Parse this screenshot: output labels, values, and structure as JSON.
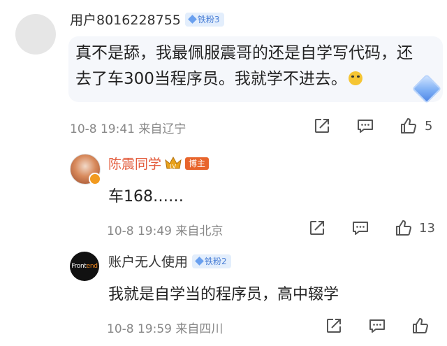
{
  "main_comment": {
    "username": "用户8016228755",
    "badge": "铁粉3",
    "text": "真不是舔，我最佩服震哥的还是自学写代码，还去了车300当程序员。我就学不进去。",
    "time": "10-8 19:41",
    "location": "来自辽宁",
    "likes": "5"
  },
  "replies": [
    {
      "username": "陈震同学",
      "badge": "博主",
      "text": "车168……",
      "time": "10-8 19:49",
      "location": "来自北京",
      "likes": "13"
    },
    {
      "username": "账户无人使用",
      "badge": "铁粉2",
      "avatar_text_1": "Front",
      "avatar_text_2": "end",
      "text": "我就是自学当的程序员，高中辍学",
      "time": "10-8 19:59",
      "location": "来自四川",
      "likes": ""
    }
  ],
  "icons": {
    "share": "share-icon",
    "comment": "comment-icon",
    "like": "thumbs-up-icon",
    "crown": "crown-icon"
  },
  "colors": {
    "badge_blue": "#4a7fd6",
    "host_orange": "#e8652c",
    "author_name": "#e35d3e",
    "meta_gray": "#888888"
  }
}
